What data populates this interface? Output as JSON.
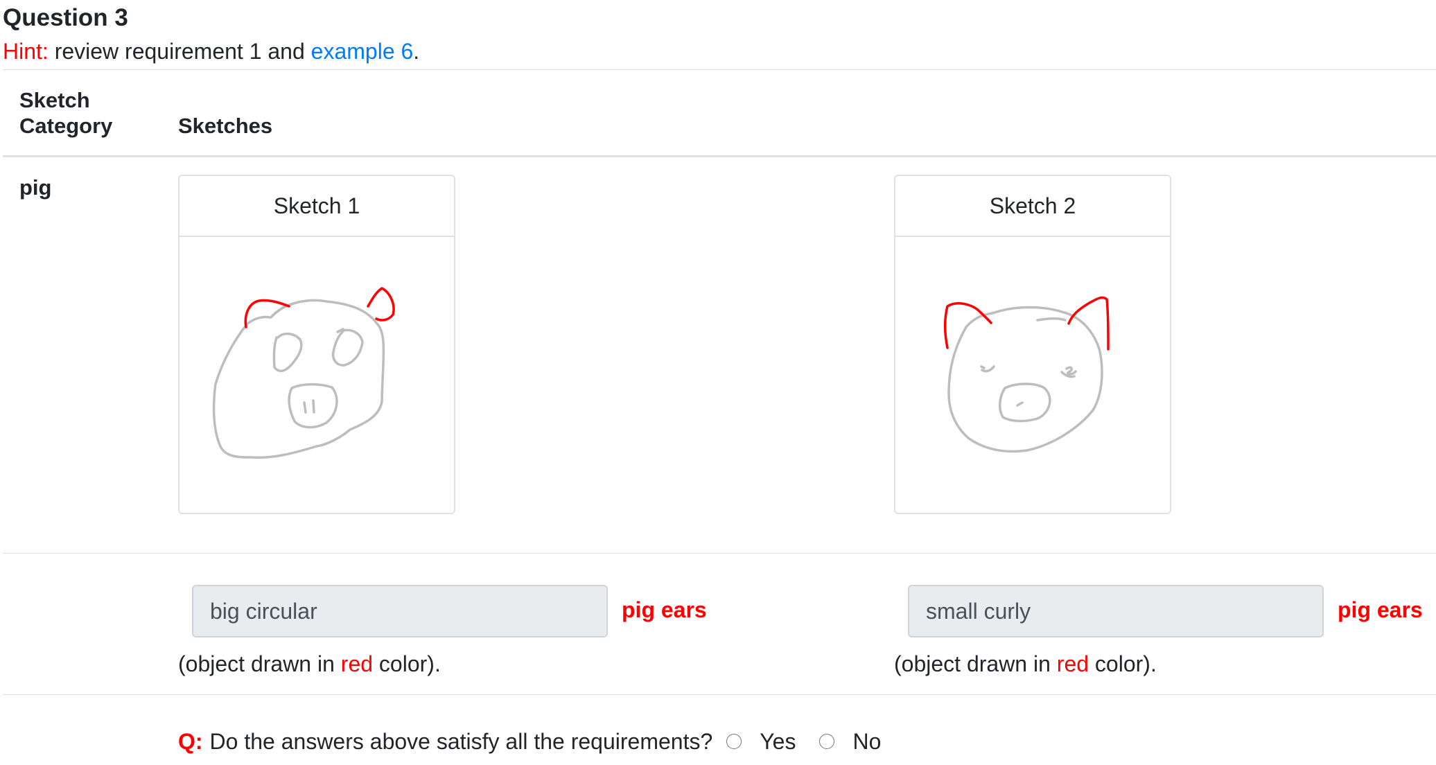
{
  "question_title": "Question 3",
  "hint": {
    "label": "Hint:",
    "text": " review requirement 1 and ",
    "link": "example 6",
    "end": "."
  },
  "table": {
    "headers": [
      "Sketch\nCategory",
      "Sketches"
    ],
    "category": "pig",
    "sketches": [
      {
        "title": "Sketch 1",
        "answer": "big circular",
        "object": "pig ears",
        "note_pre": "(object drawn in ",
        "note_color": "red",
        "note_post": " color)."
      },
      {
        "title": "Sketch 2",
        "answer": "small curly",
        "object": "pig ears",
        "note_pre": "(object drawn in ",
        "note_color": "red",
        "note_post": " color)."
      }
    ]
  },
  "question": {
    "label": "Q:",
    "text": "Do the answers above satisfy all the requirements?",
    "options": [
      "Yes",
      "No"
    ]
  },
  "colors": {
    "highlight": "#ff0000",
    "link": "#007bff",
    "sketch_stroke": "#bdbdbd"
  }
}
